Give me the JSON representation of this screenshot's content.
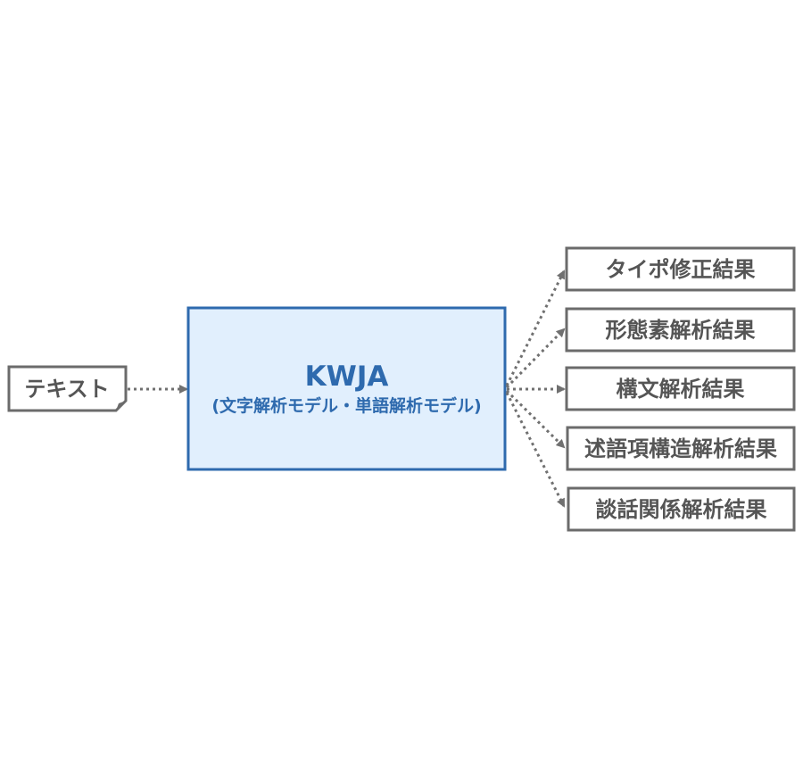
{
  "input": {
    "label": "テキスト"
  },
  "model": {
    "title": "KWJA",
    "subtitle": "(文字解析モデル・単語解析モデル)"
  },
  "outputs": [
    {
      "label": "タイポ修正結果"
    },
    {
      "label": "形態素解析結果"
    },
    {
      "label": "構文解析結果"
    },
    {
      "label": "述語項構造解析結果"
    },
    {
      "label": "談話関係解析結果"
    }
  ],
  "colors": {
    "model_fill": "#e1effd",
    "model_border": "#2e6aae",
    "box_border": "#6b6b6b",
    "text_gray": "#555555",
    "arrow": "#707070"
  }
}
